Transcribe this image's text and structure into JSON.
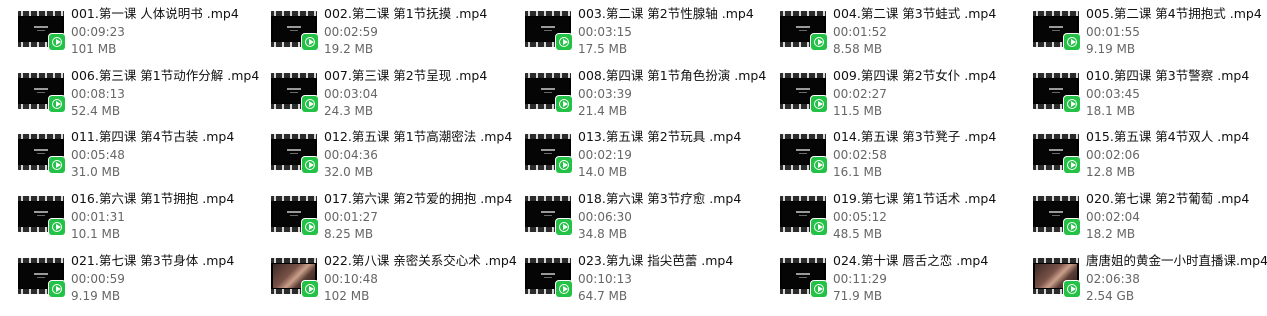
{
  "files": [
    {
      "name": "001.第一课 人体说明书 .mp4",
      "duration": "00:09:23",
      "size": "101 MB",
      "thumb": "dark"
    },
    {
      "name": "002.第二课 第1节抚摸 .mp4",
      "duration": "00:02:59",
      "size": "19.2 MB",
      "thumb": "dark"
    },
    {
      "name": "003.第二课 第2节性腺轴 .mp4",
      "duration": "00:03:15",
      "size": "17.5 MB",
      "thumb": "dark"
    },
    {
      "name": "004.第二课 第3节蛙式 .mp4",
      "duration": "00:01:52",
      "size": "8.58 MB",
      "thumb": "dark"
    },
    {
      "name": "005.第二课 第4节拥抱式 .mp4",
      "duration": "00:01:55",
      "size": "9.19 MB",
      "thumb": "dark"
    },
    {
      "name": "006.第三课 第1节动作分解 .mp4",
      "duration": "00:08:13",
      "size": "52.4 MB",
      "thumb": "dark"
    },
    {
      "name": "007.第三课 第2节呈现 .mp4",
      "duration": "00:03:04",
      "size": "24.3 MB",
      "thumb": "dark"
    },
    {
      "name": "008.第四课 第1节角色扮演 .mp4",
      "duration": "00:03:39",
      "size": "21.4 MB",
      "thumb": "dark"
    },
    {
      "name": "009.第四课 第2节女仆 .mp4",
      "duration": "00:02:27",
      "size": "11.5 MB",
      "thumb": "dark"
    },
    {
      "name": "010.第四课 第3节警察 .mp4",
      "duration": "00:03:45",
      "size": "18.1 MB",
      "thumb": "dark"
    },
    {
      "name": "011.第四课 第4节古装 .mp4",
      "duration": "00:05:48",
      "size": "31.0 MB",
      "thumb": "dark"
    },
    {
      "name": "012.第五课 第1节高潮密法 .mp4",
      "duration": "00:04:36",
      "size": "32.0 MB",
      "thumb": "dark"
    },
    {
      "name": "013.第五课 第2节玩具 .mp4",
      "duration": "00:02:19",
      "size": "14.0 MB",
      "thumb": "dark"
    },
    {
      "name": "014.第五课 第3节凳子 .mp4",
      "duration": "00:02:58",
      "size": "16.1 MB",
      "thumb": "dark"
    },
    {
      "name": "015.第五课 第4节双人 .mp4",
      "duration": "00:02:06",
      "size": "12.8 MB",
      "thumb": "dark"
    },
    {
      "name": "016.第六课 第1节拥抱 .mp4",
      "duration": "00:01:31",
      "size": "10.1 MB",
      "thumb": "dark"
    },
    {
      "name": "017.第六课 第2节爱的拥抱 .mp4",
      "duration": "00:01:27",
      "size": "8.25 MB",
      "thumb": "dark"
    },
    {
      "name": "018.第六课 第3节疗愈 .mp4",
      "duration": "00:06:30",
      "size": "34.8 MB",
      "thumb": "dark"
    },
    {
      "name": "019.第七课 第1节话术 .mp4",
      "duration": "00:05:12",
      "size": "48.5 MB",
      "thumb": "dark"
    },
    {
      "name": "020.第七课 第2节葡萄 .mp4",
      "duration": "00:02:04",
      "size": "18.2 MB",
      "thumb": "dark"
    },
    {
      "name": "021.第七课 第3节身体 .mp4",
      "duration": "00:00:59",
      "size": "9.19 MB",
      "thumb": "dark"
    },
    {
      "name": "022.第八课 亲密关系交心术 .mp4",
      "duration": "00:10:48",
      "size": "102 MB",
      "thumb": "photo"
    },
    {
      "name": "023.第九课 指尖芭蕾 .mp4",
      "duration": "00:10:13",
      "size": "64.7 MB",
      "thumb": "dark"
    },
    {
      "name": "024.第十课 唇舌之恋 .mp4",
      "duration": "00:11:29",
      "size": "71.9 MB",
      "thumb": "dark"
    },
    {
      "name": "唐唐姐的黄金一小时直播课.mp4",
      "duration": "02:06:38",
      "size": "2.54 GB",
      "thumb": "photo"
    }
  ],
  "icons": {
    "badge": "video-player-icon",
    "thumbnail": "video-thumbnail-icon"
  },
  "colors": {
    "badge": "#23c247",
    "name": "#111111",
    "meta": "#666666"
  }
}
